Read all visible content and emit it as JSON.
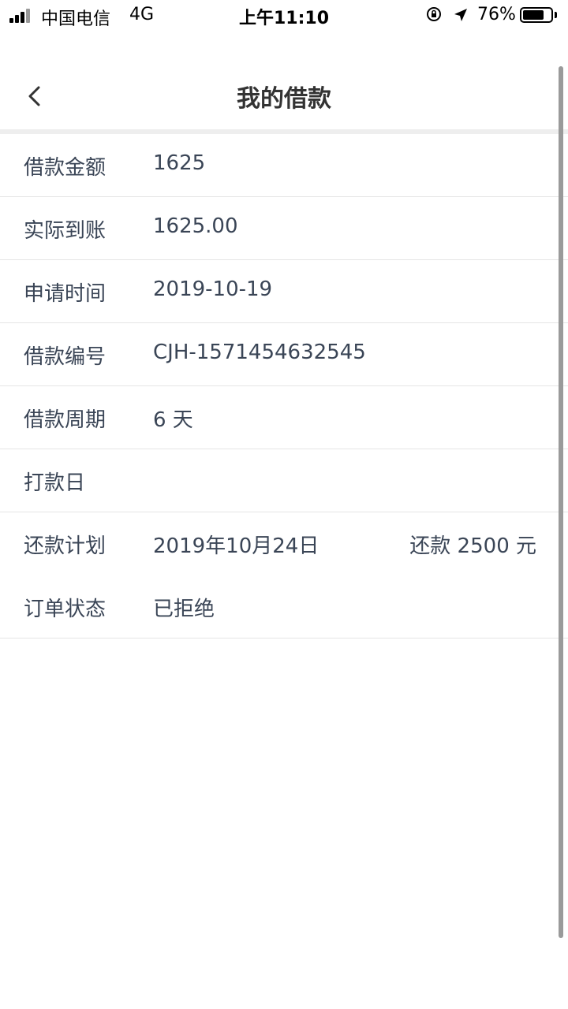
{
  "status_bar": {
    "carrier": "中国电信",
    "network": "4G",
    "time": "上午11:10",
    "battery_percent": "76%",
    "battery_level": 0.76
  },
  "nav": {
    "title": "我的借款",
    "back_icon": "chevron-left-icon"
  },
  "rows": [
    {
      "label": "借款金额",
      "value": "1625"
    },
    {
      "label": "实际到账",
      "value": "1625.00"
    },
    {
      "label": "申请时间",
      "value": "2019-10-19"
    },
    {
      "label": "借款编号",
      "value": "CJH-1571454632545"
    },
    {
      "label": "借款周期",
      "value": "6 天"
    },
    {
      "label": "打款日",
      "value": ""
    },
    {
      "label": "还款计划",
      "value": "2019年10月24日",
      "extra": "还款 2500 元"
    },
    {
      "label": "订单状态",
      "value": "已拒绝"
    }
  ],
  "colors": {
    "text": "#3a4556",
    "divider": "#e5e5e5",
    "background": "#ffffff"
  }
}
